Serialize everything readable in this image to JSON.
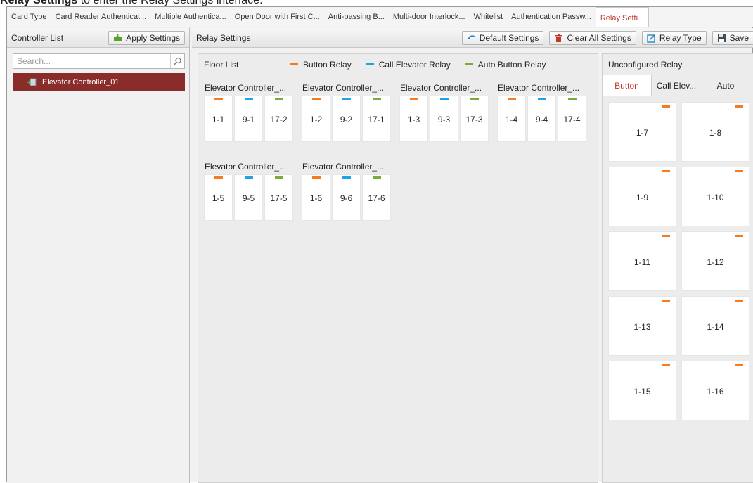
{
  "caption": {
    "bold": "Relay Settings",
    "rest": " to enter the Relay Settings interface."
  },
  "tabs": [
    {
      "label": "Card Type",
      "active": false
    },
    {
      "label": "Card Reader Authenticat...",
      "active": false
    },
    {
      "label": "Multiple Authentica...",
      "active": false
    },
    {
      "label": "Open Door with First C...",
      "active": false
    },
    {
      "label": "Anti-passing B...",
      "active": false
    },
    {
      "label": "Multi-door Interlock...",
      "active": false
    },
    {
      "label": "Whitelist",
      "active": false
    },
    {
      "label": "Authentication Passw...",
      "active": false
    },
    {
      "label": "Relay Setti...",
      "active": true
    }
  ],
  "left": {
    "title": "Controller List",
    "apply_label": "Apply Settings",
    "search_placeholder": "Search...",
    "tree_item": "Elevator Controller_01"
  },
  "mid": {
    "title": "Relay Settings",
    "toolbar": {
      "default_label": "Default Settings",
      "clear_label": "Clear All Settings",
      "relay_type_label": "Relay Type",
      "save_label": "Save"
    },
    "floor_list_title": "Floor List",
    "legend": [
      {
        "label": "Button Relay",
        "color": "#f47b20"
      },
      {
        "label": "Call Elevator Relay",
        "color": "#1ca3e8"
      },
      {
        "label": "Auto Button Relay",
        "color": "#7aaa3a"
      }
    ],
    "controllers": [
      {
        "label": "Elevator Controller_...",
        "relays": [
          "1-1",
          "9-1",
          "17-2"
        ]
      },
      {
        "label": "Elevator Controller_...",
        "relays": [
          "1-2",
          "9-2",
          "17-1"
        ]
      },
      {
        "label": "Elevator Controller_...",
        "relays": [
          "1-3",
          "9-3",
          "17-3"
        ]
      },
      {
        "label": "Elevator Controller_...",
        "relays": [
          "1-4",
          "9-4",
          "17-4"
        ]
      },
      {
        "label": "Elevator Controller_...",
        "relays": [
          "1-5",
          "9-5",
          "17-5"
        ]
      },
      {
        "label": "Elevator Controller_...",
        "relays": [
          "1-6",
          "9-6",
          "17-6"
        ]
      }
    ]
  },
  "unconfigured": {
    "title": "Unconfigured Relay",
    "tabs": [
      {
        "label": "Button",
        "active": true
      },
      {
        "label": "Call Elev...",
        "active": false
      },
      {
        "label": "Auto",
        "active": false
      }
    ],
    "relays": [
      "1-7",
      "1-8",
      "1-9",
      "1-10",
      "1-11",
      "1-12",
      "1-13",
      "1-14",
      "1-15",
      "1-16"
    ],
    "bar_color": "#f47b20"
  }
}
